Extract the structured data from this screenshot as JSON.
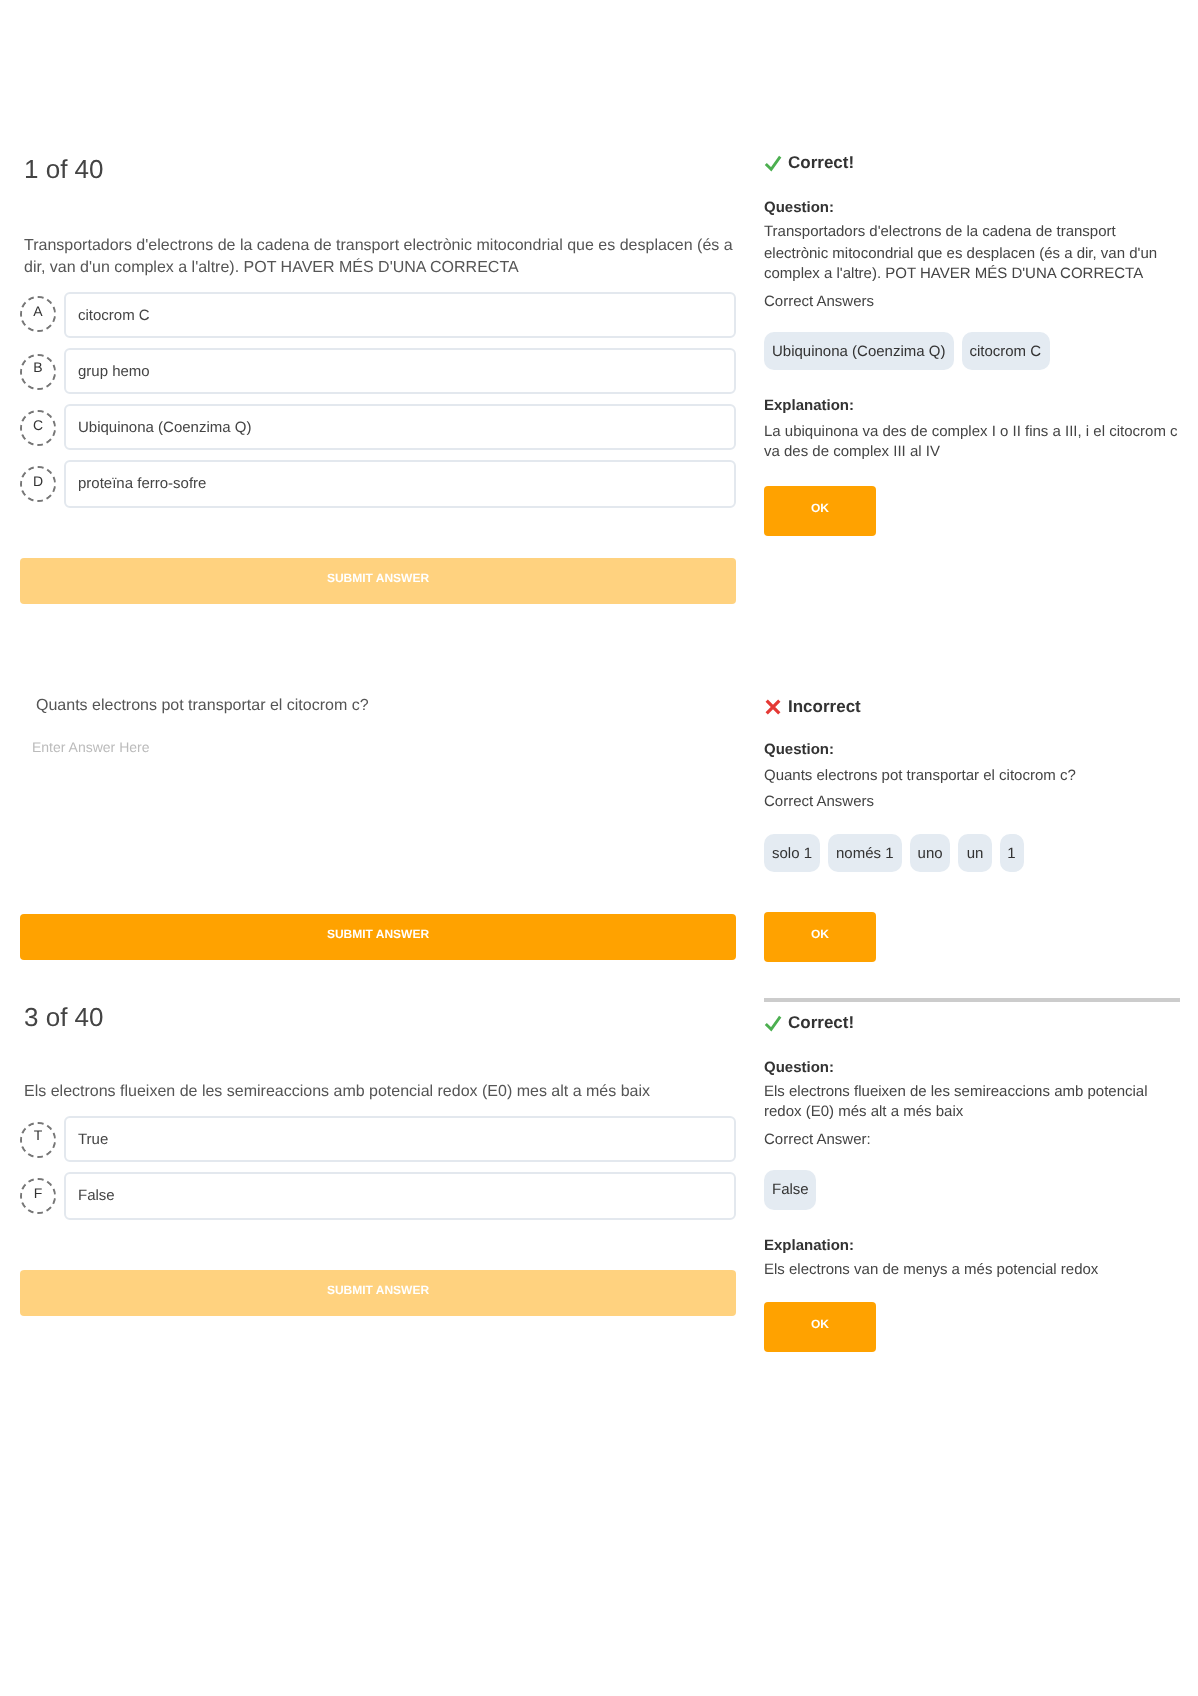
{
  "blocks": [
    {
      "counter": "1 of 40",
      "question": "Transportadors d'electrons de la cadena de transport electrònic mitocondrial que es desplacen (és a dir, van d'un complex a l'altre). POT HAVER MÉS D'UNA CORRECTA",
      "kind": "choice",
      "options": [
        {
          "letter": "A",
          "text": "citocrom C"
        },
        {
          "letter": "B",
          "text": "grup hemo"
        },
        {
          "letter": "C",
          "text": "Ubiquinona (Coenzima Q)"
        },
        {
          "letter": "D",
          "text": "proteïna ferro-sofre"
        }
      ],
      "submit": {
        "label": "SUBMIT ANSWER",
        "disabled": true
      },
      "feedback": {
        "correct": true,
        "status": "Correct!",
        "question_label": "Question:",
        "question": "Transportadors d'electrons de la cadena de transport electrònic mitocondrial que es desplacen (és a dir, van d'un complex a l'altre). POT HAVER MÉS D'UNA CORRECTA",
        "answers_label": "Correct Answers",
        "answers": [
          "Ubiquinona (Coenzima Q)",
          "citocrom C"
        ],
        "explanation_label": "Explanation:",
        "explanation": "La ubiquinona va des de complex I o II fins a III, i el citocrom c va des de complex III al IV",
        "ok": "OK"
      }
    },
    {
      "question": "Quants electrons pot transportar el citocrom c?",
      "kind": "text",
      "placeholder": "Enter Answer Here",
      "submit": {
        "label": "SUBMIT ANSWER",
        "disabled": false
      },
      "feedback": {
        "correct": false,
        "status": "Incorrect",
        "question_label": "Question:",
        "question": "Quants electrons pot transportar el citocrom c?",
        "answers_label": "Correct Answers",
        "answers": [
          "solo 1",
          "només 1",
          "uno",
          "un",
          "1"
        ],
        "ok": "OK"
      }
    },
    {
      "counter": "3 of 40",
      "question": "Els electrons flueixen de les semireaccions amb  potencial redox (E0) mes alt a més baix",
      "kind": "choice",
      "options": [
        {
          "letter": "T",
          "text": "True"
        },
        {
          "letter": "F",
          "text": "False"
        }
      ],
      "submit": {
        "label": "SUBMIT ANSWER",
        "disabled": true
      },
      "feedback": {
        "correct": true,
        "divider": true,
        "status": "Correct!",
        "question_label": "Question:",
        "question": "Els electrons flueixen de les semireaccions amb potencial redox (E0) més alt a més baix",
        "answers_label": "Correct Answer:",
        "answers": [
          "False"
        ],
        "explanation_label": "Explanation:",
        "explanation": "Els electrons van de menys a més potencial redox",
        "ok": "OK"
      }
    }
  ]
}
